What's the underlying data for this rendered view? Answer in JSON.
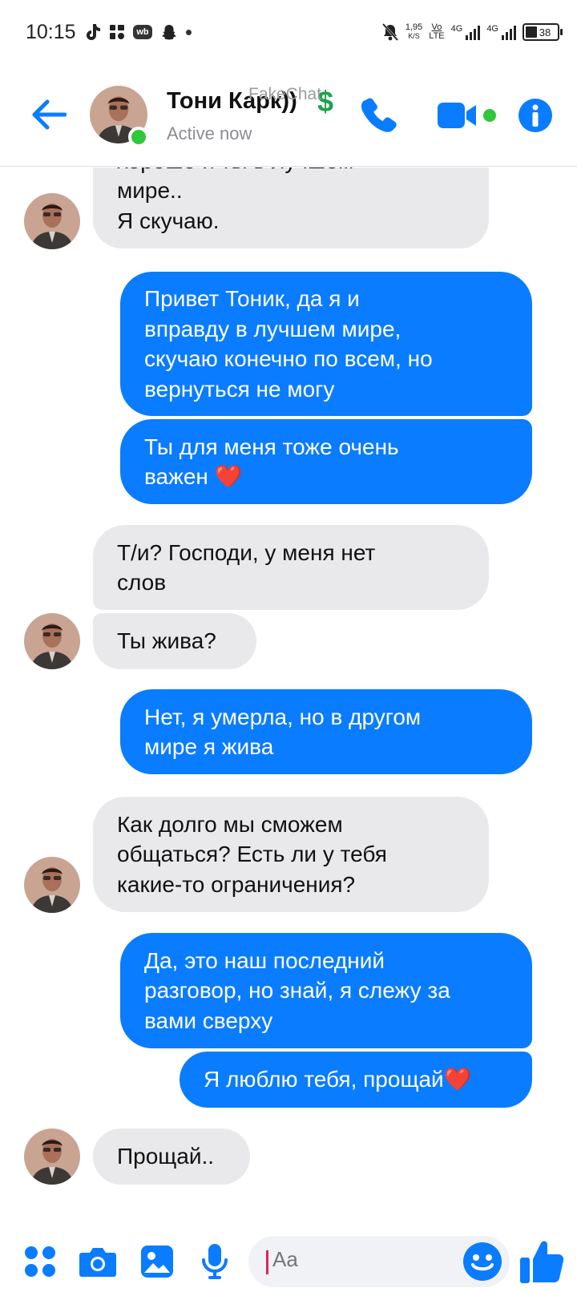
{
  "status_bar": {
    "time": "10:15",
    "net_speed": "1,95",
    "net_unit": "K/S",
    "volte_top": "Vo",
    "volte_bottom": "LTE",
    "sig1_label": "4G",
    "sig2_label": "4G",
    "battery": "38"
  },
  "header": {
    "name": "Тони Карк))",
    "badge": "$",
    "status": "Active now",
    "watermark": "FakeChat"
  },
  "colors": {
    "accent": "#0a7cff",
    "incoming": "#e9e9eb",
    "online": "#31c73b"
  },
  "messages": [
    {
      "direction": "in",
      "text": "хорошо и ты в лучшем\nмире..\nЯ скучаю."
    },
    {
      "direction": "out",
      "text": "Привет Тоник, да я и\nвправду в лучшем мире,\nскучаю конечно по всем, но\nвернуться не могу"
    },
    {
      "direction": "out",
      "text": "Ты для меня тоже очень\nважен ❤️"
    },
    {
      "direction": "in",
      "text": "Т/и? Господи, у меня нет\nслов"
    },
    {
      "direction": "in",
      "text": "Ты жива?"
    },
    {
      "direction": "out",
      "text": "Нет, я умерла, но в другом\nмире я жива"
    },
    {
      "direction": "in",
      "text": "Как долго мы сможем\nобщаться? Есть ли у тебя\nкакие-то ограничения?"
    },
    {
      "direction": "out",
      "text": "Да, это наш последний\nразговор, но знай, я слежу за\nвами сверху"
    },
    {
      "direction": "out",
      "text": "Я люблю тебя, прощай❤️"
    },
    {
      "direction": "in",
      "text": "Прощай.."
    }
  ],
  "composer": {
    "placeholder": "Aa",
    "icons": [
      "apps-icon",
      "camera-icon",
      "gallery-icon",
      "microphone-icon",
      "emoji-icon",
      "like-icon"
    ]
  }
}
